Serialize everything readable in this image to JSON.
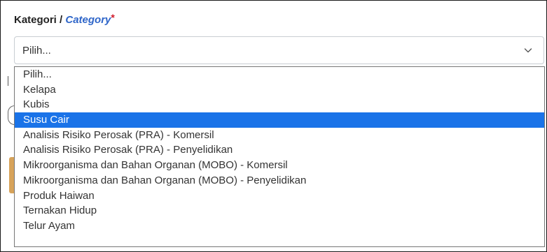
{
  "field": {
    "label_local": "Kategori",
    "separator": " / ",
    "label_english": "Category",
    "required_marker": "*"
  },
  "select": {
    "current_value": "Pilih...",
    "chevron_icon": "chevron-down-icon"
  },
  "dropdown": {
    "options": [
      {
        "label": "Pilih...",
        "highlighted": false
      },
      {
        "label": "Kelapa",
        "highlighted": false
      },
      {
        "label": "Kubis",
        "highlighted": false
      },
      {
        "label": "Susu Cair",
        "highlighted": true
      },
      {
        "label": "Analisis Risiko Perosak (PRA) - Komersil",
        "highlighted": false
      },
      {
        "label": "Analisis Risiko Perosak (PRA) - Penyelidikan",
        "highlighted": false
      },
      {
        "label": "Mikroorganisma dan Bahan Organan (MOBO) - Komersil",
        "highlighted": false
      },
      {
        "label": "Mikroorganisma dan Bahan Organan (MOBO) - Penyelidikan",
        "highlighted": false
      },
      {
        "label": "Produk Haiwan",
        "highlighted": false
      },
      {
        "label": "Ternakan Hidup",
        "highlighted": false
      },
      {
        "label": "Telur Ayam",
        "highlighted": false
      }
    ],
    "highlight_color": "#1a73e8"
  },
  "colors": {
    "label_english": "#2f66c9",
    "required": "#d11a2a",
    "background_button_fragment": "#d7a35a"
  }
}
